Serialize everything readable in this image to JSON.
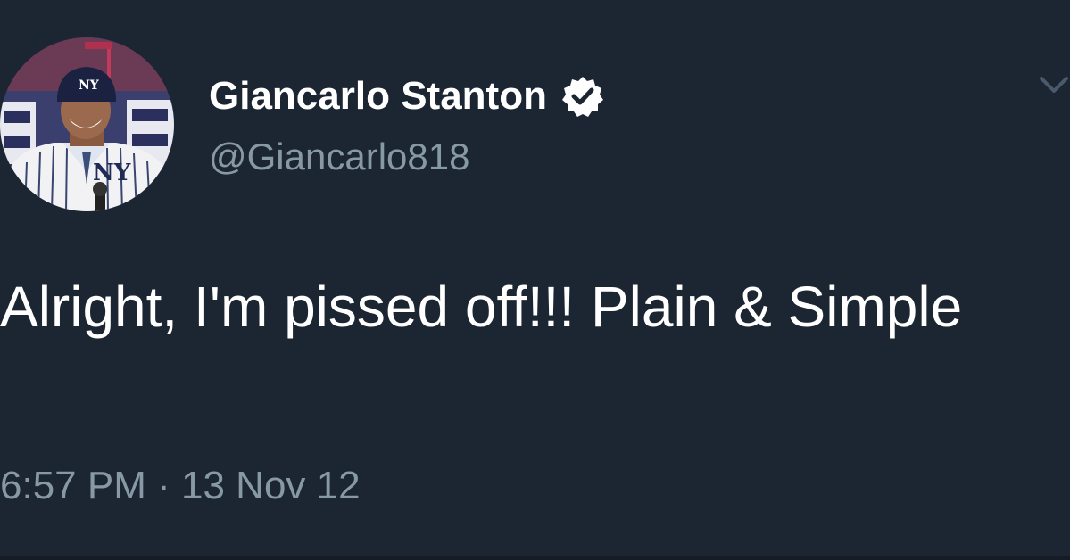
{
  "tweet": {
    "display_name": "Giancarlo Stanton",
    "handle": "@Giancarlo818",
    "text": "Alright, I'm pissed off!!! Plain & Simple",
    "time": "6:57 PM",
    "separator": "·",
    "date": "13 Nov 12"
  },
  "icons": {
    "verified": "verified-badge-icon",
    "more": "chevron-down-icon",
    "avatar": "profile-photo"
  },
  "colors": {
    "background": "#1c2532",
    "primary_text": "#ffffff",
    "secondary_text": "#8899a6"
  }
}
